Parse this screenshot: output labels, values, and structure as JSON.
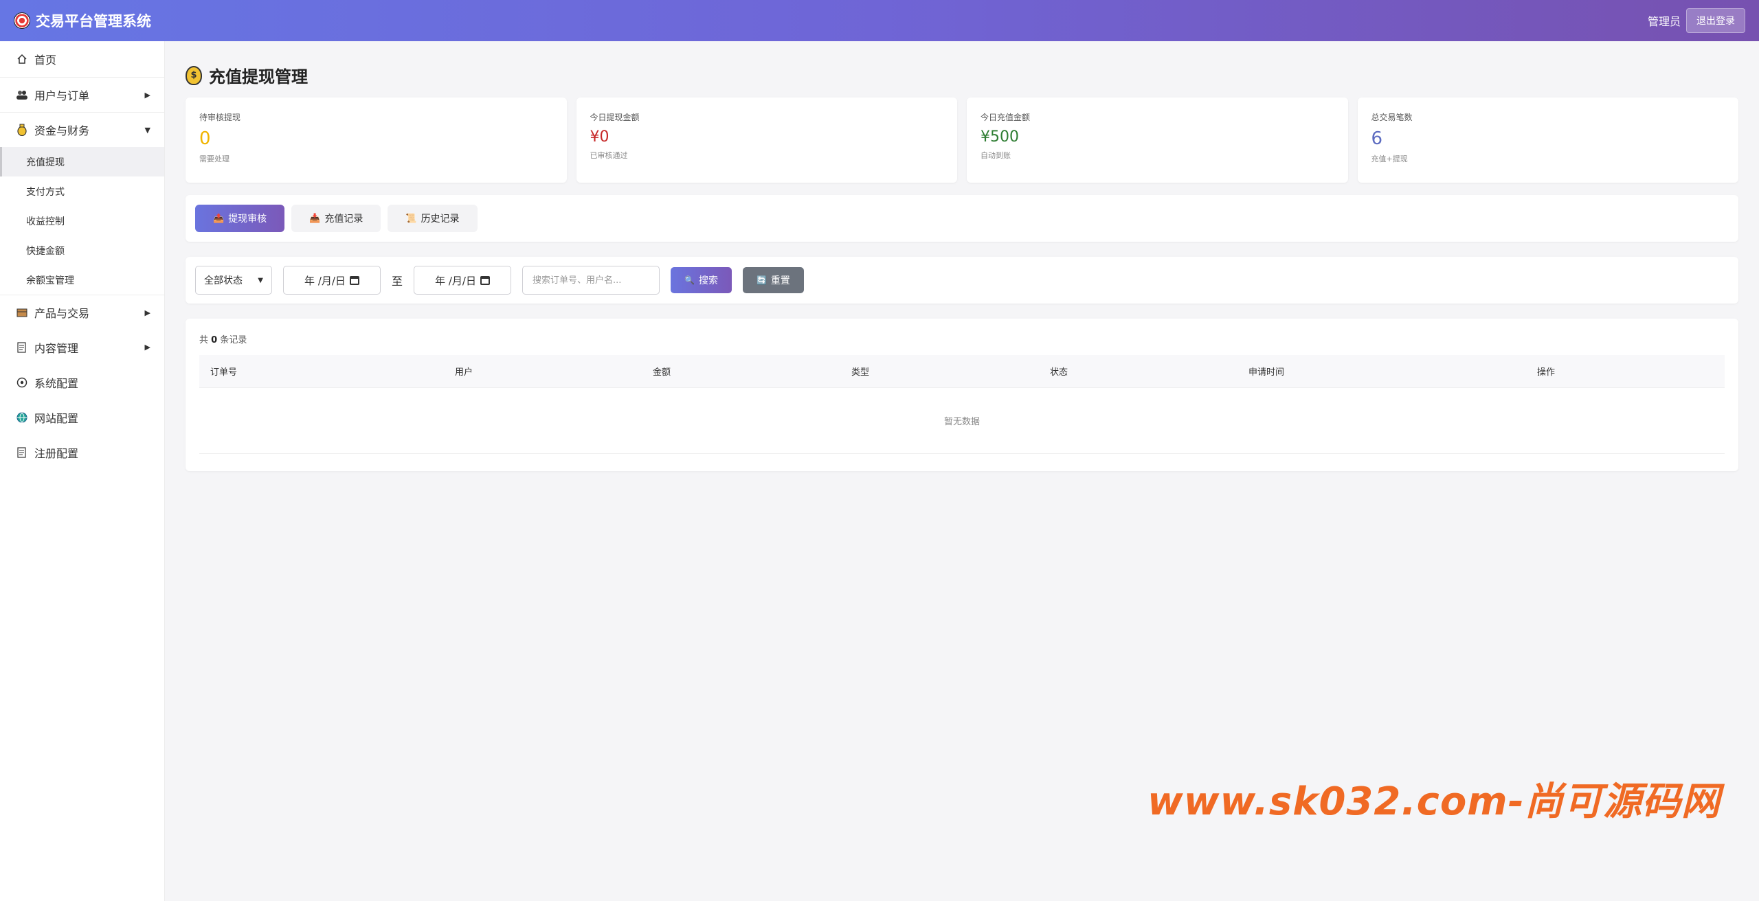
{
  "header": {
    "title": "交易平台管理系统",
    "user": "管理员",
    "logout": "退出登录"
  },
  "sidebar": {
    "items": [
      {
        "label": "首页",
        "icon": "home-icon"
      },
      {
        "label": "用户与订单",
        "icon": "users-icon"
      },
      {
        "label": "资金与财务",
        "icon": "money-bag-icon"
      },
      {
        "label": "产品与交易",
        "icon": "box-icon"
      },
      {
        "label": "内容管理",
        "icon": "memo-icon"
      },
      {
        "label": "系统配置",
        "icon": "gear-icon"
      },
      {
        "label": "网站配置",
        "icon": "globe-icon"
      },
      {
        "label": "注册配置",
        "icon": "memo-icon"
      }
    ],
    "sub_items": [
      "充值提现",
      "支付方式",
      "收益控制",
      "快捷金额",
      "余额宝管理"
    ]
  },
  "page": {
    "title": "充值提现管理"
  },
  "stats": [
    {
      "label": "待审核提现",
      "value": "0",
      "sub": "需要处理",
      "color": "#f0b400"
    },
    {
      "label": "今日提现金额",
      "value": "¥0",
      "sub": "已审核通过",
      "color": "#c62828"
    },
    {
      "label": "今日充值金额",
      "value": "¥500",
      "sub": "自动到账",
      "color": "#2e7d32"
    },
    {
      "label": "总交易笔数",
      "value": "6",
      "sub": "充值+提现",
      "color": "#5c6bc0"
    }
  ],
  "tabs": [
    "提现审核",
    "充值记录",
    "历史记录"
  ],
  "filter": {
    "status": "全部状态",
    "date_from": "年 /月/日",
    "to": "至",
    "date_to": "年 /月/日",
    "search_placeholder": "搜索订单号、用户名...",
    "search_button": "搜索",
    "reset_button": "重置"
  },
  "table": {
    "count_prefix": "共",
    "count": "0",
    "count_suffix": "条记录",
    "columns": [
      "订单号",
      "用户",
      "金额",
      "类型",
      "状态",
      "申请时间",
      "操作"
    ],
    "empty": "暂无数据"
  },
  "watermark": "www.sk032.com-尚可源码网",
  "colors": {
    "header_gradient_start": "#6676e4",
    "header_gradient_end": "#7751b0",
    "accent": "#6a74de",
    "watermark": "#f06a24"
  }
}
